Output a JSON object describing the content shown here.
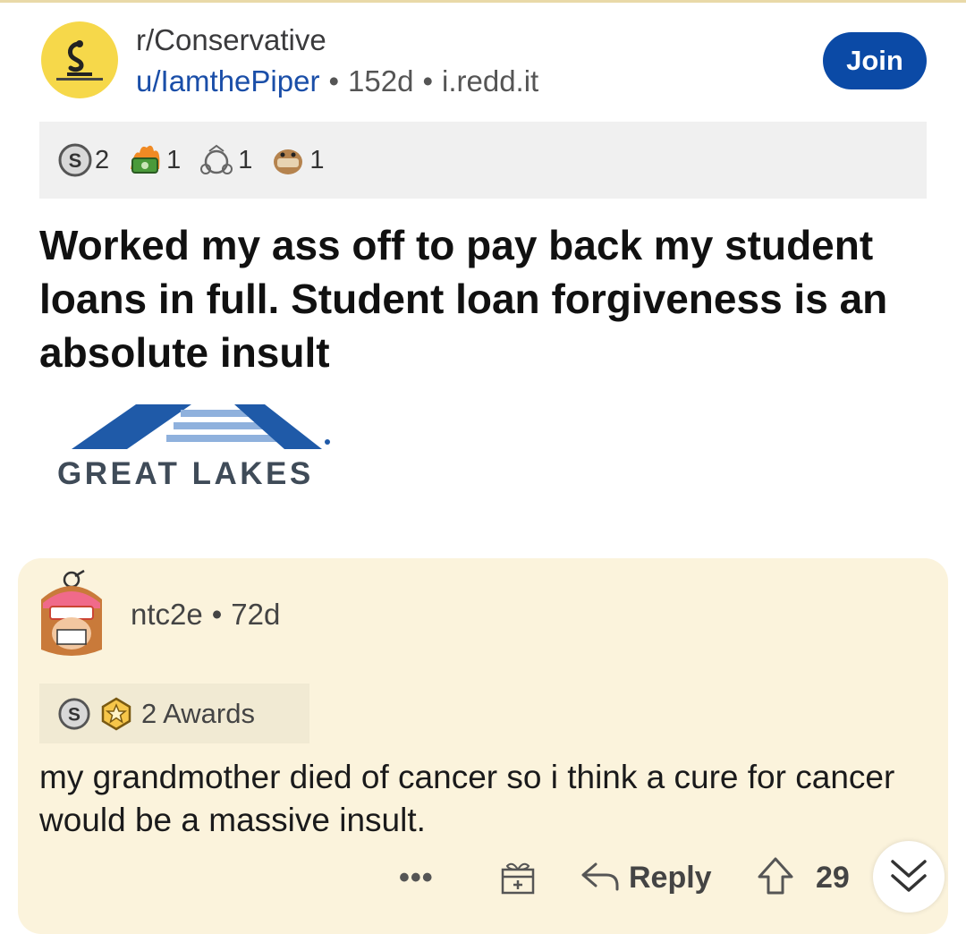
{
  "post": {
    "subreddit": "r/Conservative",
    "author": "u/IamthePiper",
    "separator": "•",
    "age": "152d",
    "domain": "i.redd.it",
    "join_label": "Join",
    "awards": [
      {
        "icon": "silver-award-icon",
        "count": "2"
      },
      {
        "icon": "money-fire-award-icon",
        "count": "1"
      },
      {
        "icon": "wholesome-award-icon",
        "count": "1"
      },
      {
        "icon": "facepalm-award-icon",
        "count": "1"
      }
    ],
    "title": "Worked my ass off to pay back my student loans in full. Student loan forgiveness is an absolute insult",
    "image": {
      "logo_text": "GREAT LAKES"
    }
  },
  "comment": {
    "author": "ntc2e",
    "separator": "•",
    "age": "72d",
    "awards_label": "2 Awards",
    "body": "my grandmother died of cancer so i think a cure for cancer would be a massive insult.",
    "actions": {
      "more": "•••",
      "reply": "Reply",
      "score": "29"
    }
  },
  "colors": {
    "join_bg": "#0b4aa6",
    "username": "#1a4ea8",
    "comment_bg": "#fbf3dc",
    "logo_blue": "#1f5aa8",
    "logo_light": "#8fb1dd"
  }
}
